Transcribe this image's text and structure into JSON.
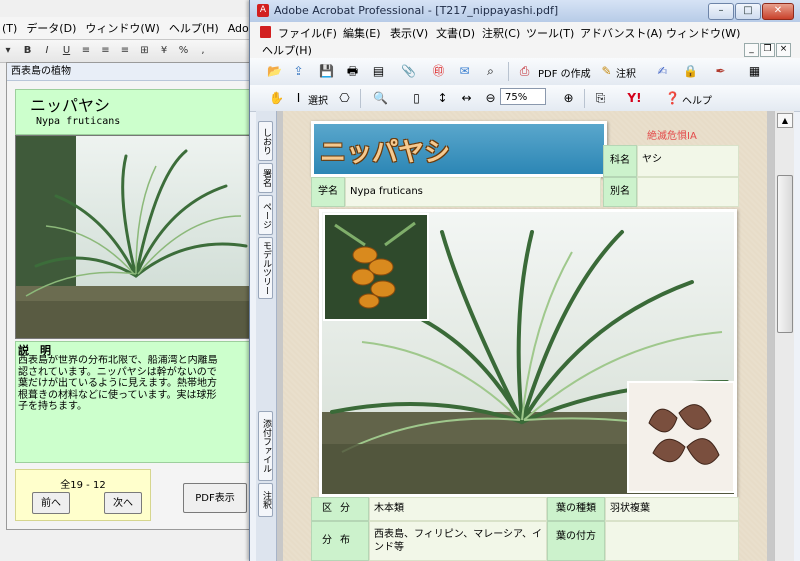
{
  "background_window": {
    "menu": [
      "(T)",
      "データ(D)",
      "ウィンドウ(W)",
      "ヘルプ(H)",
      "Adob"
    ],
    "form_title": "西表島の植物",
    "plant_name": "ニッパヤシ",
    "latin_name": "Nypa fruticans",
    "description_label": "説　明",
    "description": "西表島が世界の分布北限で、船浦湾と内離島\n認されています。ニッパヤシは幹がないので\n葉だけが出ているように見えます。熱帯地方\n根葺きの材料などに使っています。実は球形\n子を持ちます。",
    "record_count": "全19 - 12",
    "prev_button": "前へ",
    "next_button": "次へ",
    "pdf_button": "PDF表示"
  },
  "acrobat": {
    "title": "Adobe Acrobat Professional - [T217_nippayashi.pdf]",
    "menu": [
      "ファイル(F)",
      "編集(E)",
      "表示(V)",
      "文書(D)",
      "注釈(C)",
      "ツール(T)",
      "アドバンスト(A)",
      "ウィンドウ(W)"
    ],
    "menu_help": "ヘルプ(H)",
    "toolbar": {
      "create_pdf": "PDF の作成",
      "comment": "注釈",
      "select": "選択",
      "zoom": "75%",
      "help": "ヘルプ"
    },
    "nav_tabs": [
      "しおり",
      "署名",
      "ページ",
      "モデルツリー",
      "添付ファイル",
      "注釈"
    ],
    "page": {
      "title": "ニッパヤシ",
      "red_stamp": "絶滅危惧IA",
      "family_label": "科名",
      "family_value": "ヤシ",
      "alias_label": "別名",
      "alias_value": "",
      "sci_label": "学名",
      "sci_value": "Nypa fruticans",
      "category_label": "区分",
      "category_value": "木本類",
      "distribution_label": "分布",
      "distribution_value": "西表島、フィリピン、マレーシア、インド等",
      "leaf_type_label": "葉の種類",
      "leaf_type_value": "羽状複葉",
      "leaf_attach_label": "葉の付方",
      "leaf_attach_value": ""
    }
  },
  "colors": {
    "form_green": "#ccffcc",
    "form_yellow": "#ffffcc",
    "page_title_blue": "#3a95c2",
    "stamp_red": "#e34a4a"
  },
  "icons": [
    "open-icon",
    "upload-icon",
    "save-icon",
    "print-icon",
    "organizer-icon",
    "attach-icon",
    "stamp-icon",
    "email-icon",
    "search-icon",
    "create-pdf-icon",
    "comment-icon",
    "sign-icon",
    "secure-icon",
    "pen-icon",
    "forms-icon",
    "hand-tool-icon",
    "select-tool-icon",
    "snapshot-icon",
    "zoom-icon",
    "fit-page-icon",
    "fit-width-icon",
    "zoom-out-icon",
    "zoom-in-icon",
    "pages-icon",
    "yahoo-icon",
    "help-icon"
  ]
}
